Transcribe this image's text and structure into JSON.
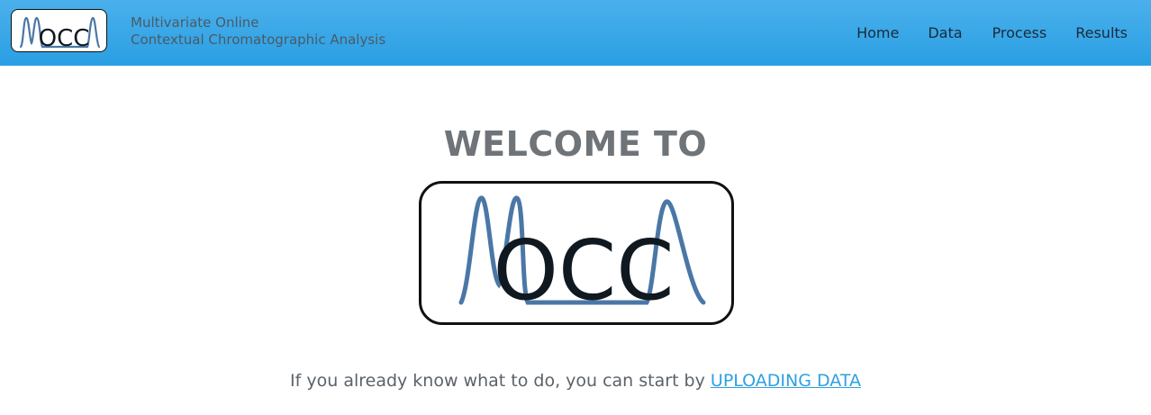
{
  "brand": {
    "logo_text": "OCC",
    "subtitle_line1": "Multivariate Online",
    "subtitle_line2": "Contextual Chromatographic Analysis"
  },
  "nav": {
    "home": "Home",
    "data": "Data",
    "process": "Process",
    "results": "Results"
  },
  "hero": {
    "heading": "WELCOME TO",
    "logo_text": "OCC"
  },
  "cta": {
    "text": "If you already know what to do, you can start by ",
    "link": "UPLOADING DATA"
  },
  "colors": {
    "navbar": "#2a9fe3",
    "logo_curve": "#4a77a6",
    "logo_text": "#101820",
    "link": "#2ea0e2"
  }
}
